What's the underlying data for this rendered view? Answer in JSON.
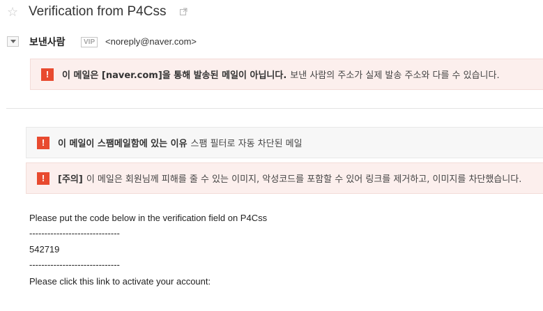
{
  "mail": {
    "subject": "Verification from P4Css",
    "sender_label": "보낸사람",
    "vip_badge": "VIP",
    "sender_email": "<noreply@naver.com>"
  },
  "alerts": {
    "naver": {
      "icon_char": "!",
      "bold": "이 메일은 [naver.com]을 통해 발송된 메일이 아닙니다.",
      "text": "보낸 사람의 주소가 실제 발송 주소와 다를 수 있습니다."
    },
    "spam": {
      "icon_char": "!",
      "bold": "이 메일이 스팸메일함에 있는 이유",
      "text": "스팸 필터로 자동 차단된 메일"
    },
    "warning": {
      "icon_char": "!",
      "bold": "[주의]",
      "text": "이 메일은 회원님께 피해를 줄 수 있는 이미지, 악성코드를 포함할 수 있어 링크를 제거하고, 이미지를 차단했습니다."
    }
  },
  "body": {
    "line1": "Please put the code below in the verification field on P4Css",
    "separator1": "------------------------------",
    "code": "542719",
    "separator2": "------------------------------",
    "line2": "Please click this link to activate your account:"
  },
  "icons": {
    "star": "star-outline-icon",
    "popout": "external-window-icon",
    "caret": "caret-down-icon",
    "alert": "exclamation-icon"
  },
  "colors": {
    "alert_red": "#e84a2f",
    "alert_bg_pink": "#fcefed",
    "alert_bg_gray": "#f7f7f7"
  }
}
